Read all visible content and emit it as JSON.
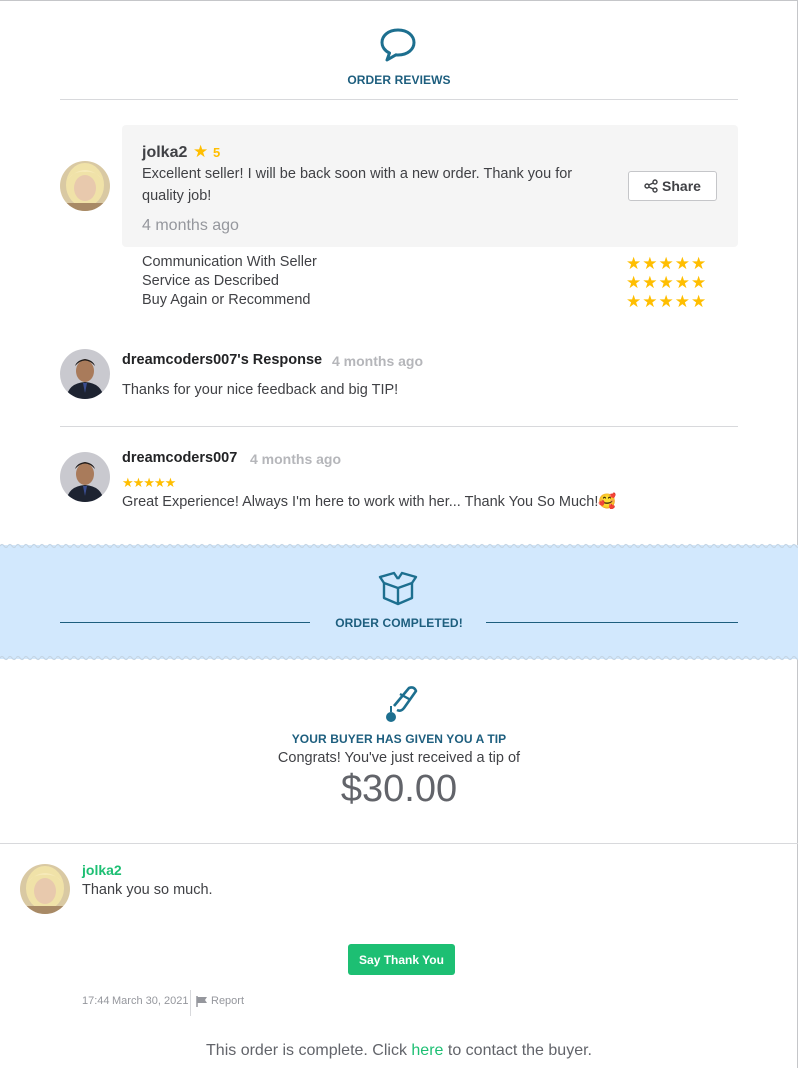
{
  "header": {
    "title": "ORDER REVIEWS",
    "icon": "chat-bubble-icon"
  },
  "review": {
    "reviewer": "jolka2",
    "rating": "5",
    "text": "Excellent seller! I will be back soon with a new order. Thank you for quality job!",
    "time": "4 months ago",
    "share_label": "Share",
    "criteria": [
      {
        "label": "Communication With Seller",
        "stars": 5
      },
      {
        "label": "Service as Described",
        "stars": 5
      },
      {
        "label": "Buy Again or Recommend",
        "stars": 5
      }
    ]
  },
  "seller_response": {
    "title": "dreamcoders007's Response",
    "time": "4 months ago",
    "text": "Thanks for your nice feedback and big TIP!"
  },
  "seller_review": {
    "name": "dreamcoders007",
    "time": "4 months ago",
    "stars": 5,
    "text": "Great Experience! Always I'm here to work with her... Thank You So Much!🥰"
  },
  "completed": {
    "title": "ORDER COMPLETED!",
    "icon": "open-box-icon",
    "band_color": "#d2e8fd"
  },
  "tip": {
    "title": "YOUR BUYER HAS GIVEN YOU A TIP",
    "subtitle": "Congrats! You've just received a tip of",
    "amount": "$30.00",
    "icon": "hand-coin-icon"
  },
  "message": {
    "sender": "jolka2",
    "text": "Thank you so much.",
    "button_label": "Say Thank You",
    "time": "17:44",
    "date": "March 30, 2021",
    "report_label": "Report"
  },
  "footer": {
    "before": "This order is complete. Click ",
    "link": "here",
    "after": " to contact the buyer."
  },
  "colors": {
    "accent": "#1dbf73",
    "heading": "#1d5e7e",
    "star": "#ffbe00"
  }
}
